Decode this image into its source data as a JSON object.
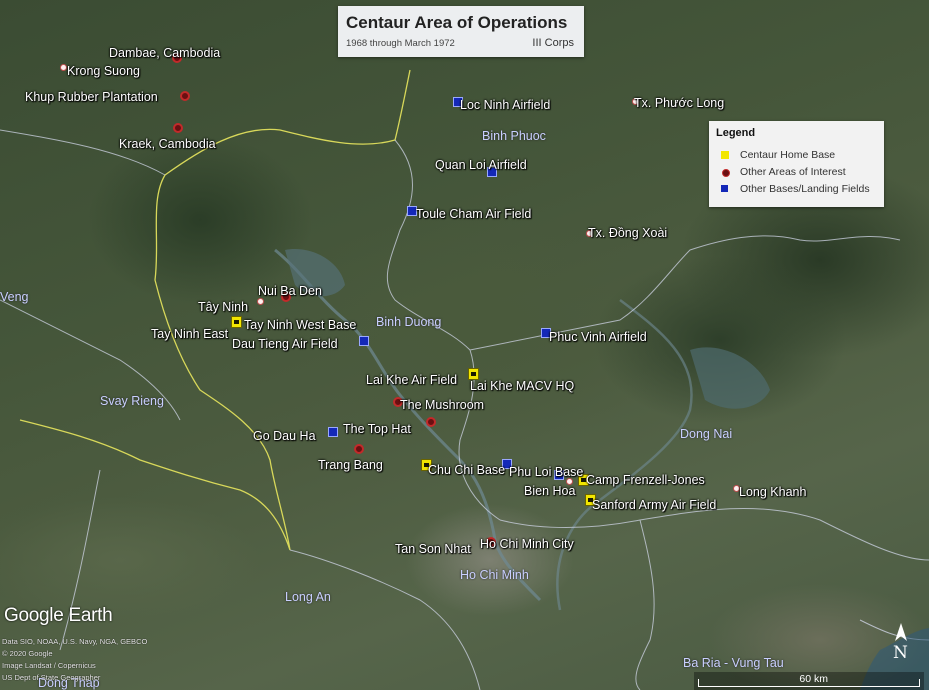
{
  "title": {
    "main": "Centaur Area of Operations",
    "sub": "1968 through March 1972",
    "corps": "III Corps"
  },
  "legend": {
    "title": "Legend",
    "items": [
      {
        "label": "Centaur Home Base",
        "symbol": "home"
      },
      {
        "label": "Other Areas of Interest",
        "symbol": "poi"
      },
      {
        "label": "Other Bases/Landing Fields",
        "symbol": "base"
      }
    ]
  },
  "places": [
    {
      "name": "Dambae, Cambodia"
    },
    {
      "name": "Krong Suong"
    },
    {
      "name": "Khup Rubber Plantation"
    },
    {
      "name": "Kraek, Cambodia"
    },
    {
      "name": "Loc Ninh Airfield"
    },
    {
      "name": "Tx. Phước Long"
    },
    {
      "name": "Quan Loi Airfield"
    },
    {
      "name": "Toule Cham Air Field"
    },
    {
      "name": "Tx. Đồng Xoài"
    },
    {
      "name": "Nui Ba Den"
    },
    {
      "name": "Tây Ninh"
    },
    {
      "name": "Tay Ninh West Base"
    },
    {
      "name": "Tay Ninh East"
    },
    {
      "name": "Dau Tieng Air Field"
    },
    {
      "name": "Phuc Vinh Airfield"
    },
    {
      "name": "Lai Khe Air Field"
    },
    {
      "name": "Lai Khe MACV HQ"
    },
    {
      "name": "The Mushroom"
    },
    {
      "name": "The Top Hat"
    },
    {
      "name": "Go Dau Ha"
    },
    {
      "name": "Trang Bang"
    },
    {
      "name": "Chu Chi Base"
    },
    {
      "name": "Phu Loi Base"
    },
    {
      "name": "Camp Frenzell-Jones"
    },
    {
      "name": "Bien Hoa"
    },
    {
      "name": "Long Khanh"
    },
    {
      "name": "Sanford Army Air Field"
    },
    {
      "name": "Tan Son Nhat"
    },
    {
      "name": "Ho Chi Minh City"
    }
  ],
  "regions": [
    {
      "name": "Binh Phuoc"
    },
    {
      "name": "Binh Duong"
    },
    {
      "name": "Dong Nai"
    },
    {
      "name": "Svay Rieng"
    },
    {
      "name": "Long An"
    },
    {
      "name": "Ho Chi Minh"
    },
    {
      "name": "Ba Ria - Vung Tau"
    },
    {
      "name": "Veng"
    },
    {
      "name": "Dong Thap"
    }
  ],
  "branding": {
    "logo": "Google Earth",
    "credits": [
      "Data SIO, NOAA, U.S. Navy, NGA, GEBCO",
      "© 2020 Google",
      "Image Landsat / Copernicus",
      "US Dept of State Geographer"
    ]
  },
  "scale": {
    "label": "60 km"
  },
  "compass": {
    "label": "N"
  },
  "colors": {
    "home_base": "#f2e600",
    "area_of_interest": "#8b1a1a",
    "other_base": "#1428b8",
    "border": "#d8d85a",
    "region_label": "#c9cfff"
  }
}
